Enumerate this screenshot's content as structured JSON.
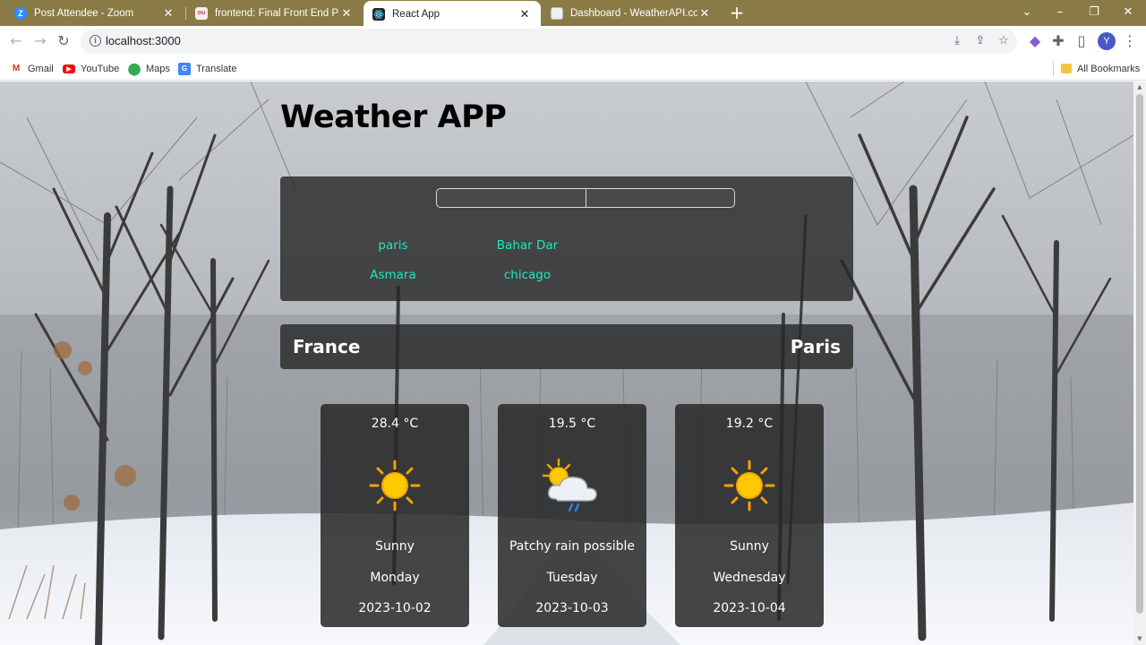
{
  "browser": {
    "tabs": [
      {
        "title": "Post Attendee - Zoom",
        "favicon": "zoom-icon",
        "active": false
      },
      {
        "title": "frontend: Final Front End Project",
        "favicon": "project-icon",
        "active": false
      },
      {
        "title": "React App",
        "favicon": "react-icon",
        "active": true
      },
      {
        "title": "Dashboard - WeatherAPI.com",
        "favicon": "weatherapi-icon",
        "active": false
      }
    ],
    "url": "localhost:3000",
    "avatar_letter": "Y",
    "bookmarks": [
      {
        "label": "Gmail",
        "icon": "gmail-icon"
      },
      {
        "label": "YouTube",
        "icon": "youtube-icon"
      },
      {
        "label": "Maps",
        "icon": "maps-icon"
      },
      {
        "label": "Translate",
        "icon": "translate-icon"
      }
    ],
    "all_bookmarks_label": "All Bookmarks"
  },
  "app": {
    "title": "Weather APP",
    "search": {
      "value": "",
      "placeholder": "",
      "button_label": ""
    },
    "quick_cities": [
      "paris",
      "Bahar Dar",
      "Asmara",
      "chicago"
    ],
    "accent_color": "#20e8c0",
    "location": {
      "country": "France",
      "city": "Paris"
    },
    "forecast": [
      {
        "temp": "28.4 °C",
        "icon": "sunny-icon",
        "condition": "Sunny",
        "day": "Monday",
        "date": "2023-10-02"
      },
      {
        "temp": "19.5 °C",
        "icon": "patchy-rain-icon",
        "condition": "Patchy rain possible",
        "day": "Tuesday",
        "date": "2023-10-03"
      },
      {
        "temp": "19.2 °C",
        "icon": "sunny-icon",
        "condition": "Sunny",
        "day": "Wednesday",
        "date": "2023-10-04"
      }
    ]
  }
}
